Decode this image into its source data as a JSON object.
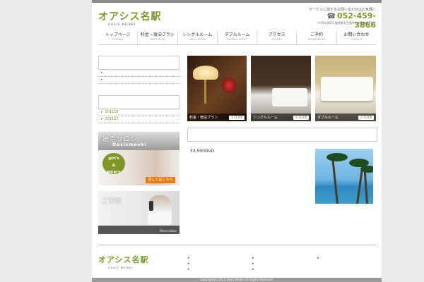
{
  "header": {
    "logo_text": "オアシス名駅",
    "logo_sub": "OASIS MEIEKI",
    "contact_note": "サービスに関するお問い合わせはお気軽に",
    "phone": "052-459-3866",
    "address": "〒453-0015 愛知県名古屋市中村区椿町13-6"
  },
  "nav": [
    {
      "label": "トップページ",
      "sub": "TOPPAGE"
    },
    {
      "label": "料金・宿泊プラン",
      "sub": "PRICE PLAN"
    },
    {
      "label": "シングルルーム",
      "sub": "SINGLE ROOM"
    },
    {
      "label": "ダブルルーム",
      "sub": "DOUBLE ROOM"
    },
    {
      "label": "アクセス",
      "sub": "ACCESS"
    },
    {
      "label": "ご予約",
      "sub": "RESERVATION"
    },
    {
      "label": "お問い合わせ",
      "sub": "CONTACT"
    }
  ],
  "sidebar": {
    "archive": [
      {
        "label": "201118"
      },
      {
        "label": "201117"
      }
    ]
  },
  "banner_salon": {
    "title": "脱毛サロン",
    "subtitle": "Oasismeeki",
    "badge_lines": [
      "girl's",
      "&",
      "MEN'S"
    ],
    "button": "詳しくはこちら"
  },
  "banner_reserve": {
    "title": "ご予約",
    "bar_label": "Reservation"
  },
  "photos": [
    {
      "caption": "料金・宿泊プラン",
      "button": "> CLICK"
    },
    {
      "caption": "シングルルーム",
      "button": "> CLICK"
    },
    {
      "caption": "ダブルルーム",
      "button": "> CLICK"
    }
  ],
  "main": {
    "price_text": "33,500DVD"
  },
  "footer": {
    "logo_text": "オアシス名駅",
    "logo_sub": "OASIS MEIEKI",
    "copyright": "Copyright(c) 2011 Oasis Meieki All Rights Reserved."
  }
}
